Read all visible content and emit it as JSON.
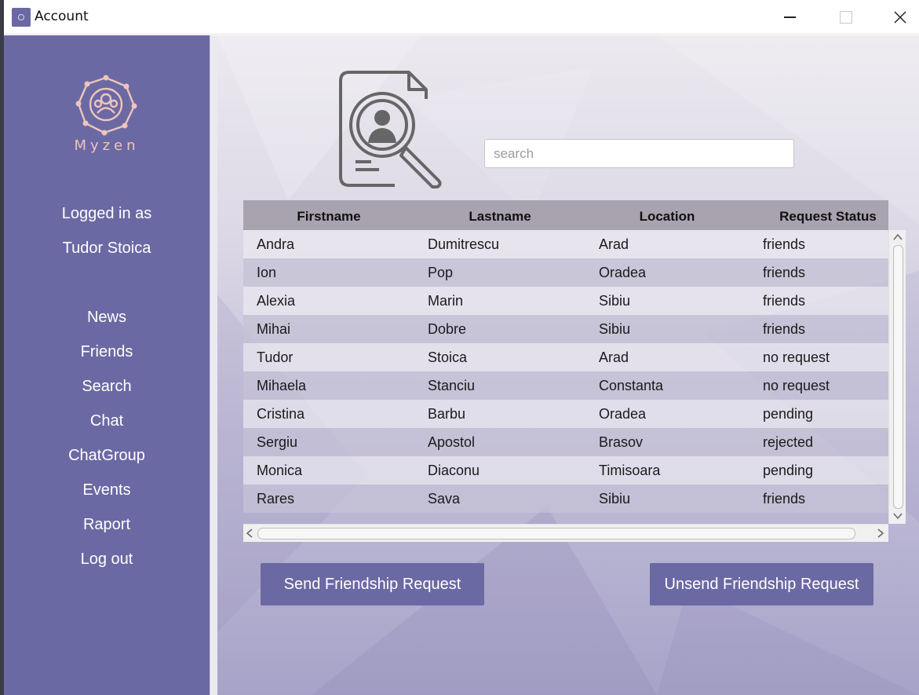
{
  "window": {
    "title": "Account"
  },
  "sidebar": {
    "brand": "Myzen",
    "logged_in_label": "Logged in as",
    "user_name": "Tudor Stoica",
    "nav": [
      "News",
      "Friends",
      "Search",
      "Chat",
      "ChatGroup",
      "Events",
      "Raport",
      "Log out"
    ]
  },
  "search": {
    "placeholder": "search",
    "value": ""
  },
  "table": {
    "columns": [
      "Firstname",
      "Lastname",
      "Location",
      "Request Status"
    ],
    "rows": [
      [
        "Andra",
        "Dumitrescu",
        "Arad",
        "friends"
      ],
      [
        "Ion",
        "Pop",
        "Oradea",
        "friends"
      ],
      [
        "Alexia",
        "Marin",
        "Sibiu",
        "friends"
      ],
      [
        "Mihai",
        "Dobre",
        "Sibiu",
        "friends"
      ],
      [
        "Tudor",
        "Stoica",
        "Arad",
        "no request"
      ],
      [
        "Mihaela",
        "Stanciu",
        "Constanta",
        "no request"
      ],
      [
        "Cristina",
        "Barbu",
        "Oradea",
        "pending"
      ],
      [
        "Sergiu",
        "Apostol",
        "Brasov",
        "rejected"
      ],
      [
        "Monica",
        "Diaconu",
        "Timisoara",
        "pending"
      ],
      [
        "Rares",
        "Sava",
        "Sibiu",
        "friends"
      ]
    ]
  },
  "actions": {
    "send_label": "Send Friendship Request",
    "unsend_label": "Unsend Friendship Request"
  },
  "colors": {
    "sidebar": "#6b69a3",
    "button": "#6b69a3",
    "brand_text": "#eec4bd",
    "table_header": "#a8a3af"
  },
  "icons": [
    "app-icon",
    "myzen-logo-icon",
    "profile-search-icon",
    "minimize-icon",
    "maximize-icon",
    "close-icon"
  ]
}
